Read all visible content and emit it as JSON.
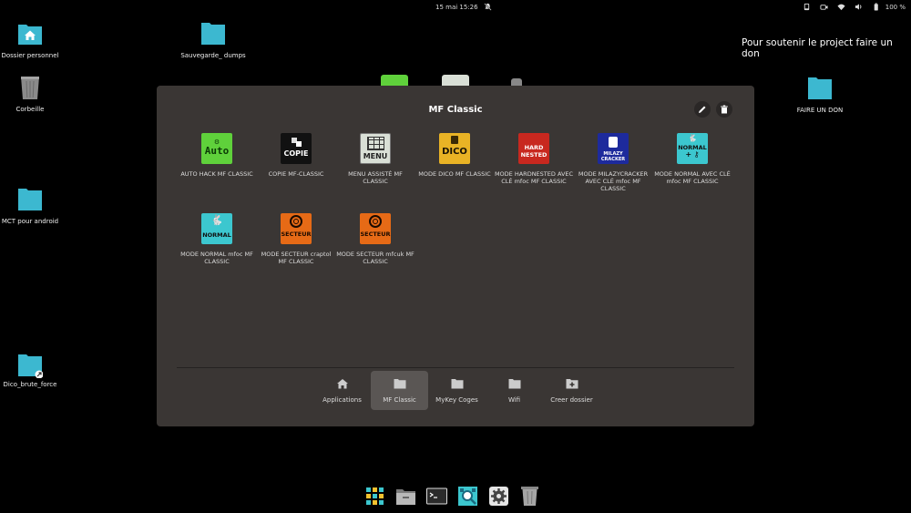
{
  "topbar": {
    "clock": "15 mai  15:26",
    "battery": "100 %",
    "icons": [
      "notifications-muted-icon",
      "phone-icon",
      "camera-icon",
      "wifi-icon",
      "volume-icon",
      "battery-icon"
    ]
  },
  "desktop": {
    "icons": [
      {
        "name": "home-folder",
        "label": "Dossier personnel"
      },
      {
        "name": "trash",
        "label": "Corbeille"
      },
      {
        "name": "mct-folder",
        "label": "MCT pour android"
      },
      {
        "name": "dico-folder",
        "label": "Dico_brute_force"
      },
      {
        "name": "backup-folder",
        "label": "Sauvegarde_ dumps"
      },
      {
        "name": "donate-folder",
        "label": "FAIRE UN DON"
      }
    ],
    "donate_text": "Pour soutenir le project faire un don"
  },
  "window": {
    "title": "MF Classic",
    "edit_icon": "pencil-icon",
    "delete_icon": "trash-icon",
    "apps": [
      {
        "label": "AUTO HACK MF CLASSIC",
        "icon_text": "Auto",
        "color": "#5fd13b"
      },
      {
        "label": "COPIE MF-CLASSIC",
        "icon_text": "COPIE",
        "color": "#111111"
      },
      {
        "label": "MENU ASSISTÉ MF CLASSIC",
        "icon_text": "MENU",
        "color": "#d9dfd6"
      },
      {
        "label": "MODE DICO MF CLASSIC",
        "icon_text": "DICO",
        "color": "#e9b325"
      },
      {
        "label": "MODE HARDNESTED AVEC CLÉ mfoc MF CLASSIC",
        "icon_text": "HARD NESTED",
        "color": "#c8281f"
      },
      {
        "label": "MODE MILAZYCRACKER AVEC CLÉ mfoc MF CLASSIC",
        "icon_text": "MILAZY CRACKER",
        "color": "#1d2a9c"
      },
      {
        "label": "MODE NORMAL AVEC CLÉ mfoc MF CLASSIC",
        "icon_text": "NORMAL",
        "color": "#3cc7cf"
      },
      {
        "label": "MODE NORMAL mfoc MF CLASSIC",
        "icon_text": "NORMAL",
        "color": "#3cc7cf"
      },
      {
        "label": "MODE SECTEUR craptol MF CLASSIC",
        "icon_text": "SECTEUR",
        "color": "#e66a16"
      },
      {
        "label": "MODE SECTEUR mfcuk MF CLASSIC",
        "icon_text": "SECTEUR",
        "color": "#e66a16"
      }
    ],
    "tabs": [
      {
        "label": "Applications",
        "icon": "home-icon"
      },
      {
        "label": "MF Classic",
        "icon": "folder-icon"
      },
      {
        "label": "MyKey Coges",
        "icon": "folder-icon"
      },
      {
        "label": "Wifi",
        "icon": "folder-icon"
      },
      {
        "label": "Creer dossier",
        "icon": "folder-plus-icon"
      }
    ],
    "active_tab": "MF Classic"
  },
  "dock": {
    "items": [
      "app-grid-icon",
      "file-manager-icon",
      "terminal-icon",
      "search-tool-icon",
      "settings-icon",
      "trash-icon"
    ]
  },
  "colors": {
    "folder": "#3cb8d0",
    "window_bg": "#3a3634",
    "active_tab_bg": "#5a5654"
  }
}
